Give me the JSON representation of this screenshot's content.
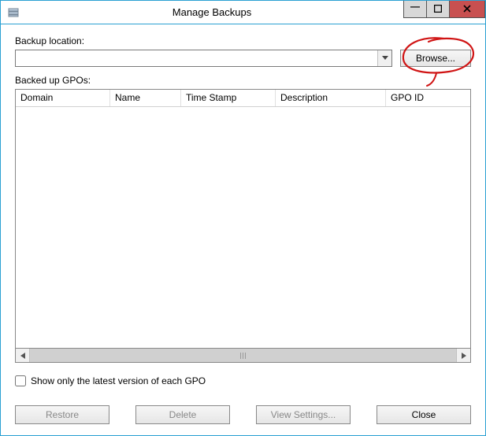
{
  "window": {
    "title": "Manage Backups"
  },
  "labels": {
    "backup_location": "Backup location:",
    "backed_up_gpos": "Backed up GPOs:",
    "show_latest": "Show only the latest version of each GPO"
  },
  "location_input": {
    "value": "",
    "placeholder": ""
  },
  "buttons": {
    "browse": "Browse...",
    "restore": "Restore",
    "delete": "Delete",
    "view_settings": "View Settings...",
    "close": "Close"
  },
  "columns": {
    "domain": "Domain",
    "name": "Name",
    "time_stamp": "Time Stamp",
    "description": "Description",
    "gpo_id": "GPO ID"
  },
  "checkbox": {
    "show_latest_checked": false
  }
}
